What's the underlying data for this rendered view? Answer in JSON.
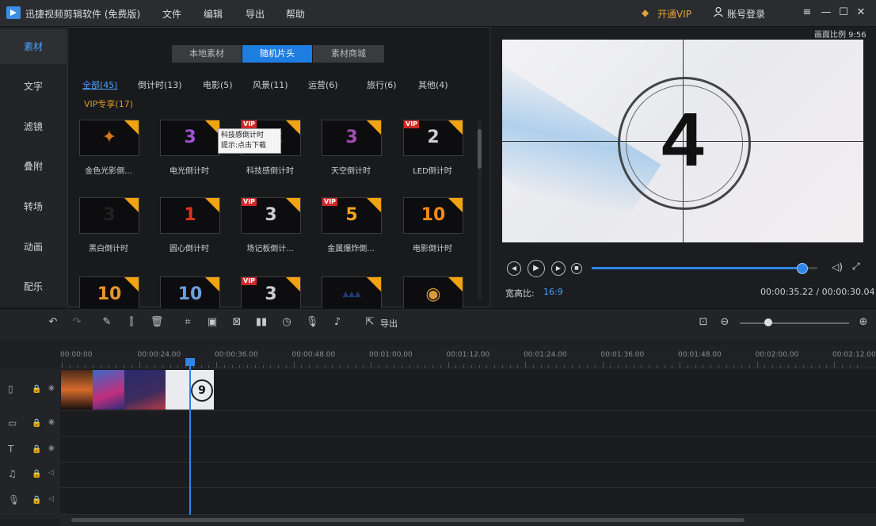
{
  "app": {
    "title": "迅捷视频剪辑软件 (免费版)",
    "menu": [
      "文件",
      "编辑",
      "导出",
      "帮助"
    ],
    "vip_label": "开通VIP",
    "login_label": "账号登录",
    "window_controls": [
      "≡",
      "—",
      "☐",
      "✕"
    ]
  },
  "sidebar": {
    "items": [
      {
        "label": "素材",
        "active": true
      },
      {
        "label": "文字",
        "active": false
      },
      {
        "label": "滤镜",
        "active": false
      },
      {
        "label": "叠附",
        "active": false
      },
      {
        "label": "转场",
        "active": false
      },
      {
        "label": "动画",
        "active": false
      },
      {
        "label": "配乐",
        "active": false
      }
    ]
  },
  "library": {
    "tabs": [
      {
        "label": "本地素材",
        "active": false
      },
      {
        "label": "随机片头",
        "active": true
      },
      {
        "label": "素材商城",
        "active": false
      }
    ],
    "categories": [
      {
        "label": "全部(45)",
        "active": true
      },
      {
        "label": "倒计时(13)",
        "active": false
      },
      {
        "label": "电影(5)",
        "active": false
      },
      {
        "label": "风景(11)",
        "active": false
      },
      {
        "label": "运营(6)",
        "active": false
      },
      {
        "label": "旅行(6)",
        "active": false
      },
      {
        "label": "其他(4)",
        "active": false
      }
    ],
    "vip_category": "VIP专享(17)",
    "thumbnails": [
      {
        "label": "金色光影倒...",
        "glyph": "✦",
        "vip": false,
        "color": "#d8771a"
      },
      {
        "label": "电光倒计时",
        "glyph": "3",
        "vip": false,
        "color": "#9b55d6"
      },
      {
        "label": "科技感倒计时",
        "glyph": "12",
        "vip": true,
        "color": "#4fb5d8"
      },
      {
        "label": "天空倒计时",
        "glyph": "3",
        "vip": false,
        "color": "#a24fb0"
      },
      {
        "label": "LED倒计时",
        "glyph": "2",
        "vip": true,
        "color": "#cfcfcf"
      },
      {
        "label": "黑白倒计时",
        "glyph": "3",
        "vip": false,
        "color": "#222222"
      },
      {
        "label": "圆心倒计时",
        "glyph": "1",
        "vip": false,
        "color": "#e0321f"
      },
      {
        "label": "场记板倒计...",
        "glyph": "3",
        "vip": true,
        "color": "#cccccc"
      },
      {
        "label": "金属爆炸倒...",
        "glyph": "5",
        "vip": true,
        "color": "#f0a21f"
      },
      {
        "label": "电影倒计时",
        "glyph": "10",
        "vip": false,
        "color": "#f08a19"
      },
      {
        "label": "",
        "glyph": "10",
        "vip": false,
        "color": "#e8962a"
      },
      {
        "label": "",
        "glyph": "10",
        "vip": false,
        "color": "#6aa0e0"
      },
      {
        "label": "",
        "glyph": "3",
        "vip": true,
        "color": "#cccccc"
      },
      {
        "label": "",
        "glyph": "▲▲▲",
        "vip": false,
        "color": "#243a74"
      },
      {
        "label": "",
        "glyph": "◉",
        "vip": false,
        "color": "#d89a3a"
      }
    ],
    "tooltip": "科技感倒计时\n提示:点击下载"
  },
  "preview": {
    "ratio_badge": "画面比例 9:56",
    "countdown_number": "4",
    "aspect_label": "宽高比:",
    "aspect_value": "16:9",
    "time": "00:00:35.22 / 00:00:30.04",
    "seek_progress": 0.93
  },
  "toolbar": {
    "export_label": "导出"
  },
  "timeline": {
    "ticks": [
      "00:00:00",
      "00:00:24.00",
      "00:00:36.00",
      "00:00:48.00",
      "00:01:00.00",
      "00:01:12.00",
      "00:01:24.00",
      "00:01:36.00",
      "00:01:48.00",
      "00:02:00.00",
      "00:02:12.00"
    ],
    "clip_number": "9"
  }
}
